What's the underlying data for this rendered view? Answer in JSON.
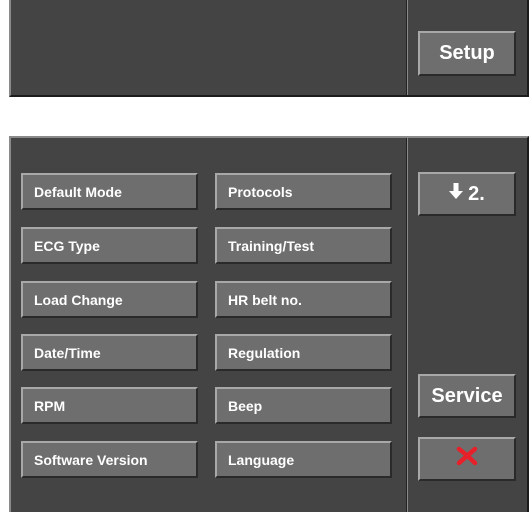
{
  "header": {
    "setup_label": "Setup"
  },
  "menu": {
    "left": [
      {
        "label": "Default Mode"
      },
      {
        "label": "ECG Type"
      },
      {
        "label": "Load Change"
      },
      {
        "label": "Date/Time"
      },
      {
        "label": "RPM"
      },
      {
        "label": "Software Version"
      }
    ],
    "right": [
      {
        "label": "Protocols"
      },
      {
        "label": "Training/Test"
      },
      {
        "label": "HR belt no."
      },
      {
        "label": "Regulation"
      },
      {
        "label": "Beep"
      },
      {
        "label": "Language"
      }
    ]
  },
  "side": {
    "page_label": "2.",
    "page_icon": "arrow-down-icon",
    "service_label": "Service",
    "close_icon": "close-icon",
    "close_color": "#e8202a"
  },
  "colors": {
    "panel": "#444444",
    "button": "#6e6e6e",
    "text": "#ffffff"
  }
}
